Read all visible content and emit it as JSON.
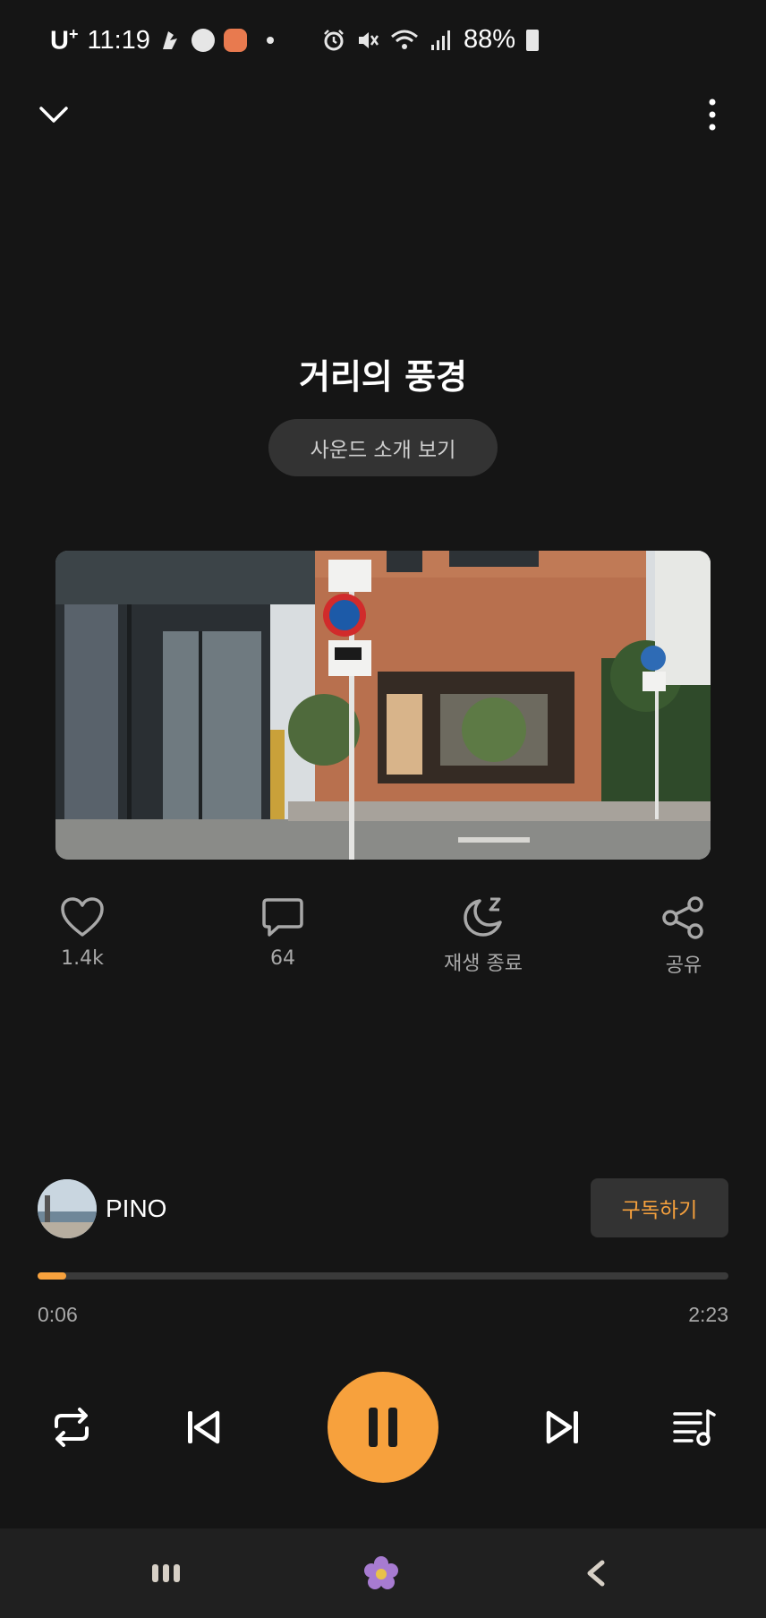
{
  "status_bar": {
    "carrier": "U",
    "carrier_sup": "+",
    "time": "11:19",
    "battery": "88%"
  },
  "track": {
    "title": "거리의 풍경",
    "intro_button": "사운드 소개 보기"
  },
  "actions": {
    "like_count": "1.4k",
    "comment_count": "64",
    "sleep_label": "재생 종료",
    "share_label": "공유"
  },
  "channel": {
    "name": "PINO",
    "subscribe_label": "구독하기"
  },
  "playback": {
    "current_time": "0:06",
    "total_time": "2:23",
    "progress_fraction": 0.042,
    "state": "playing"
  },
  "colors": {
    "accent": "#f7a13d",
    "background": "#151515",
    "surface": "#333333",
    "nav_bar": "#202020"
  },
  "icons": {
    "collapse": "chevron-down-icon",
    "more": "more-vertical-icon",
    "like": "heart-icon",
    "comment": "comment-icon",
    "sleep": "moon-zzz-icon",
    "share": "share-icon",
    "repeat": "repeat-icon",
    "previous": "skip-previous-icon",
    "pause": "pause-icon",
    "next": "skip-next-icon",
    "playlist": "playlist-icon"
  }
}
